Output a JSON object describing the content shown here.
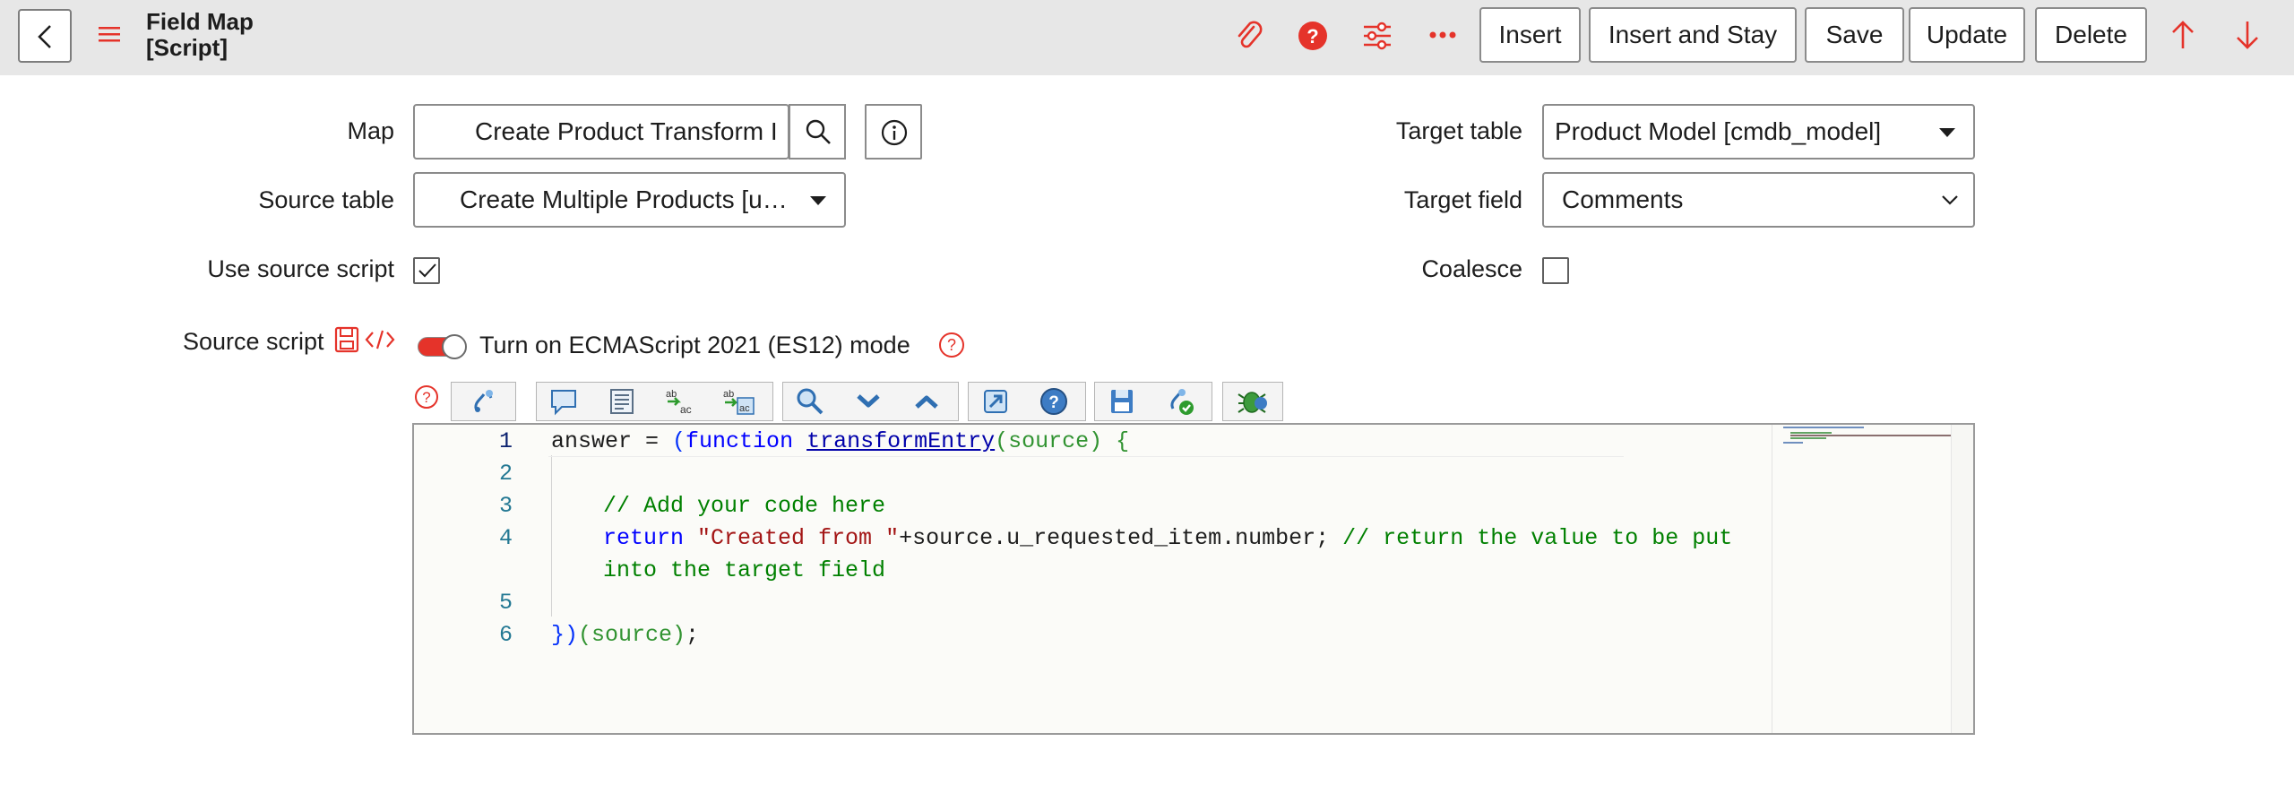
{
  "header": {
    "title_line1": "Field Map",
    "title_line2": "[Script]",
    "buttons": {
      "insert": "Insert",
      "insert_stay": "Insert and Stay",
      "save": "Save",
      "update": "Update",
      "delete": "Delete"
    },
    "icons": [
      "chevron-left-icon",
      "hamburger-menu-icon",
      "paperclip-icon",
      "help-icon",
      "settings-sliders-icon",
      "more-icon",
      "arrow-up-icon",
      "arrow-down-icon"
    ]
  },
  "form": {
    "map": {
      "label": "Map",
      "value": "Create Product Transform I"
    },
    "source_table": {
      "label": "Source table",
      "value": "Create Multiple Products [u…"
    },
    "use_source_script": {
      "label": "Use source script",
      "checked": true
    },
    "source_script": {
      "label": "Source script"
    },
    "target_table": {
      "label": "Target table",
      "value": "Product Model [cmdb_model]"
    },
    "target_field": {
      "label": "Target field",
      "value": "Comments"
    },
    "coalesce": {
      "label": "Coalesce",
      "checked": false
    },
    "es_toggle": {
      "label": "Turn on ECMAScript 2021 (ES12) mode",
      "on": false
    }
  },
  "colors": {
    "accent_red": "#e5332a",
    "header_bg": "#e7e7e7",
    "toolbar_blue": "#2f6fb2"
  },
  "editor": {
    "line_numbers": [
      "1",
      "2",
      "3",
      "4",
      "5",
      "6"
    ],
    "line1": {
      "a": "answer = ",
      "b": "(",
      "c": "function ",
      "d": "transformEntry",
      "e": "(source)",
      "f": " {"
    },
    "line3": "// Add your code here",
    "line4": {
      "a": "return ",
      "b": "\"Created from \"",
      "c": "+source.u_requested_item.number; ",
      "d": "// return the value to be put"
    },
    "line4_wrap": "into the target field",
    "line6": {
      "a": "})",
      "b": "(source)",
      "c": ";"
    }
  }
}
